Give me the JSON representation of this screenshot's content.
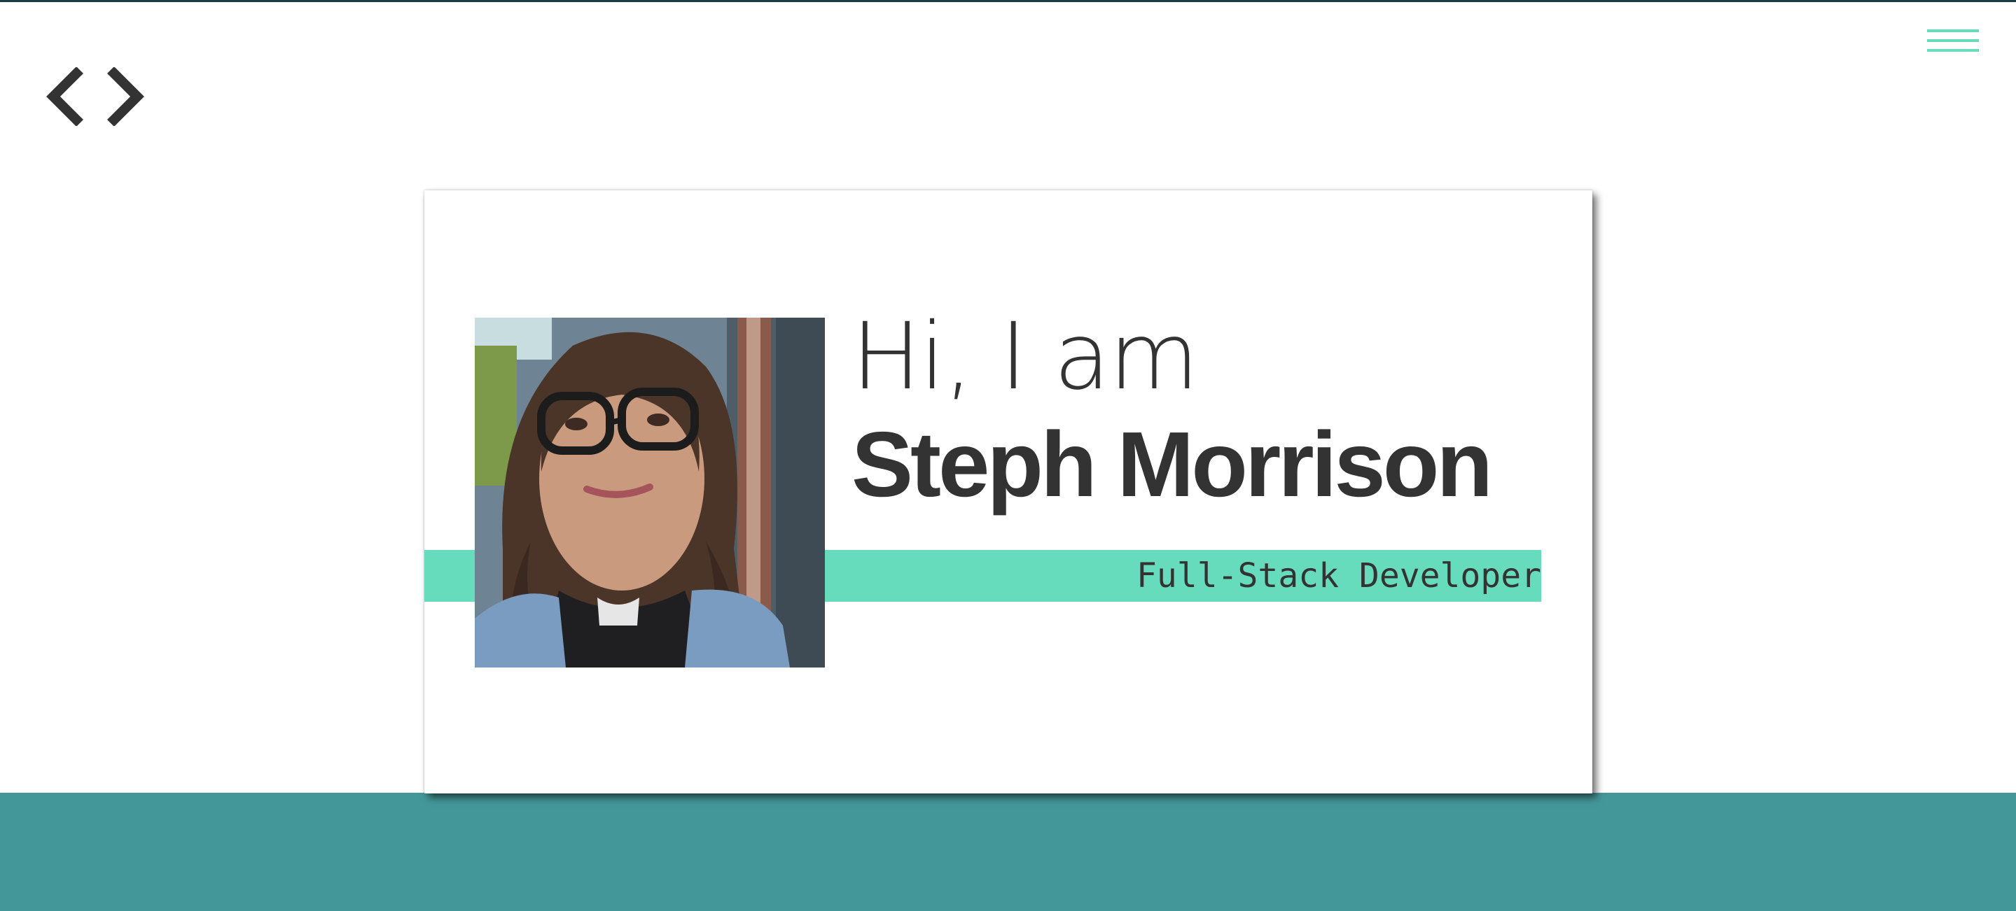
{
  "header": {
    "logo_icon": "code-brackets-icon",
    "menu_icon": "hamburger-menu-icon"
  },
  "hero": {
    "greeting": "Hi, I am",
    "name": "Steph Morrison",
    "role": "Full-Stack Developer",
    "photo_alt": "Steph Morrison"
  },
  "colors": {
    "accent": "#67dcbc",
    "band": "#449799",
    "text": "#333333",
    "top_border": "#1d3b44"
  }
}
